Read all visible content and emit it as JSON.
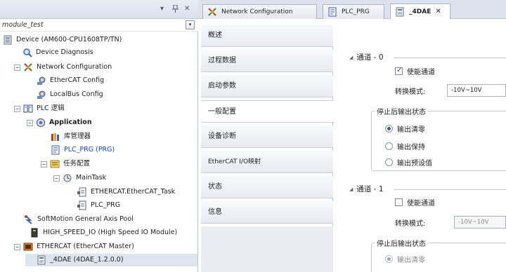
{
  "left_panel": {
    "controls": {
      "dropdown": "▾",
      "pin": "ᵖ",
      "close": "✕"
    },
    "project": {
      "name": "module_test",
      "dropdown_glyph": "▾"
    },
    "tree": [
      {
        "label": "Device (AM600-CPU1608TP/TN)",
        "expander": "",
        "icon": "device-icon"
      },
      {
        "label": "Device Diagnosis",
        "expander": "",
        "icon": "diagnosis-icon"
      },
      {
        "label": "Network Configuration",
        "expander": "−",
        "icon": "network-config-icon"
      },
      {
        "label": "EtherCAT Config",
        "expander": "",
        "icon": "gear-config-icon"
      },
      {
        "label": "LocalBus Config",
        "expander": "",
        "icon": "gear-config-icon"
      },
      {
        "label": "PLC 逻辑",
        "expander": "−",
        "icon": "plc-logic-icon"
      },
      {
        "label": "Application",
        "expander": "−",
        "icon": "application-icon"
      },
      {
        "label": "库管理器",
        "expander": "",
        "icon": "library-manager-icon"
      },
      {
        "label": "PLC_PRG (PRG)",
        "expander": "",
        "icon": "program-icon"
      },
      {
        "label": "任务配置",
        "expander": "−",
        "icon": "task-config-icon"
      },
      {
        "label": "MainTask",
        "expander": "−",
        "icon": "task-icon"
      },
      {
        "label": "ETHERCAT.EtherCAT_Task",
        "expander": "",
        "icon": "task-call-icon"
      },
      {
        "label": "PLC_PRG",
        "expander": "",
        "icon": "task-call-icon"
      },
      {
        "label": "SoftMotion General Axis Pool",
        "expander": "",
        "icon": "axis-pool-icon"
      },
      {
        "label": "HIGH_SPEED_IO (High Speed IO Module)",
        "expander": "",
        "icon": "io-module-icon"
      },
      {
        "label": "ETHERCAT (EtherCAT Master)",
        "expander": "−",
        "icon": "ethercat-master-icon"
      },
      {
        "label": "_4DAE (4DAE_1.2.0.0)",
        "expander": "",
        "icon": "module-icon"
      }
    ]
  },
  "tabs": [
    {
      "label": "Network Configuration",
      "icon": "network-config-icon"
    },
    {
      "label": "PLC_PRG",
      "icon": "program-icon"
    },
    {
      "label": "_4DAE",
      "icon": "module-icon",
      "close": "✕"
    }
  ],
  "side_nav": [
    "概述",
    "过程数据",
    "启动参数",
    "一般配置",
    "设备诊断",
    "EtherCAT I/O映射",
    "状态",
    "信息"
  ],
  "channels": [
    {
      "title": "通道 - 0",
      "enable_label": "使能通道",
      "enabled": true,
      "mode_label": "转换模式:",
      "mode_value": "-10V~10V",
      "stop_group": "停止后输出状态",
      "options": [
        "输出清零",
        "输出保持",
        "输出预设值"
      ]
    },
    {
      "title": "通道 - 1",
      "enable_label": "使能通道",
      "enabled": false,
      "mode_label": "转换模式:",
      "mode_value": "-10V~10V",
      "stop_group": "停止后输出状态",
      "options": [
        "输出清零"
      ]
    }
  ],
  "colors": {
    "link_blue": "#1a3fd1",
    "selection": "#dfe5ee",
    "panel_border": "#b9c1cc"
  }
}
